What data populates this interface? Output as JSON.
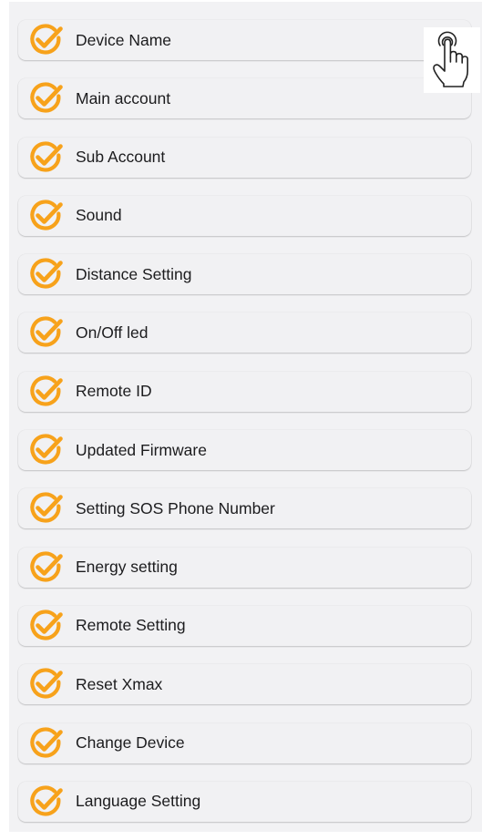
{
  "menu": {
    "items": [
      {
        "label": "Device Name",
        "icon": "orange-check-circle-icon"
      },
      {
        "label": "Main account",
        "icon": "orange-check-circle-icon"
      },
      {
        "label": "Sub Account",
        "icon": "orange-check-circle-icon"
      },
      {
        "label": "Sound",
        "icon": "orange-check-circle-icon"
      },
      {
        "label": "Distance Setting",
        "icon": "orange-check-circle-icon"
      },
      {
        "label": "On/Off led",
        "icon": "orange-check-circle-icon"
      },
      {
        "label": "Remote ID",
        "icon": "orange-check-circle-icon"
      },
      {
        "label": "Updated Firmware",
        "icon": "orange-check-circle-icon"
      },
      {
        "label": "Setting SOS Phone Number",
        "icon": "orange-check-circle-icon"
      },
      {
        "label": "Energy setting",
        "icon": "orange-check-circle-icon"
      },
      {
        "label": "Remote Setting",
        "icon": "orange-check-circle-icon"
      },
      {
        "label": "Reset Xmax",
        "icon": "orange-check-circle-icon"
      },
      {
        "label": "Change Device",
        "icon": "orange-check-circle-icon"
      },
      {
        "label": "Language Setting",
        "icon": "orange-check-circle-icon"
      }
    ]
  },
  "cursor": {
    "icon": "tap-hand-icon"
  },
  "colors": {
    "accent": "#f7a21b",
    "text": "#1c1c1e",
    "background": "#f2f2f4",
    "item_background": "#f1f1f3"
  }
}
